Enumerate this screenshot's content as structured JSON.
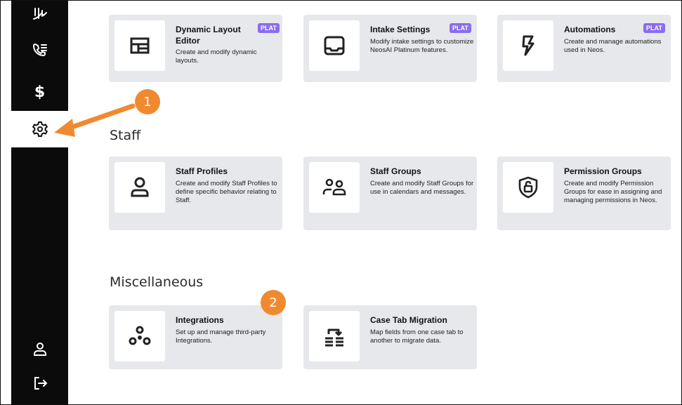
{
  "colors": {
    "sidebar_bg": "#0b0b0b",
    "card_bg": "#e7e8ec",
    "badge_bg": "#8b6cf0",
    "marker_bg": "#f08a30"
  },
  "sidebar": {
    "items": [
      {
        "icon": "chart-icon"
      },
      {
        "icon": "phone-list-icon"
      },
      {
        "icon": "dollar-icon",
        "label": "$"
      },
      {
        "icon": "gear-icon",
        "active": true
      },
      {
        "icon": "user-icon"
      },
      {
        "icon": "logout-icon"
      }
    ]
  },
  "top_cards": [
    {
      "title": "Dynamic Layout Editor",
      "badge": "PLAT",
      "description": "Create and modify dynamic layouts.",
      "icon": "layout-icon"
    },
    {
      "title": "Intake Settings",
      "badge": "PLAT",
      "description": "Modify intake settings to customize NeosAI Platinum features.",
      "icon": "inbox-icon"
    },
    {
      "title": "Automations",
      "badge": "PLAT",
      "description": "Create and manage automations used in Neos.",
      "icon": "lightning-icon"
    }
  ],
  "staff": {
    "title": "Staff",
    "cards": [
      {
        "title": "Staff Profiles",
        "description": "Create and modify Staff Profiles to define specific behavior relating to Staff.",
        "icon": "person-icon"
      },
      {
        "title": "Staff Groups",
        "description": "Create and modify Staff Groups for use in calendars and messages.",
        "icon": "group-icon"
      },
      {
        "title": "Permission Groups",
        "description": "Create and modify Permission Groups for ease in assigning and managing permissions in Neos.",
        "icon": "shield-lock-icon"
      }
    ]
  },
  "misc": {
    "title": "Miscellaneous",
    "cards": [
      {
        "title": "Integrations",
        "description": "Set up and manage third-party Integrations.",
        "icon": "integrations-icon"
      },
      {
        "title": "Case Tab Migration",
        "description": "Map fields from one case tab to another to migrate data.",
        "icon": "migration-icon"
      }
    ]
  },
  "markers": [
    "1",
    "2"
  ]
}
